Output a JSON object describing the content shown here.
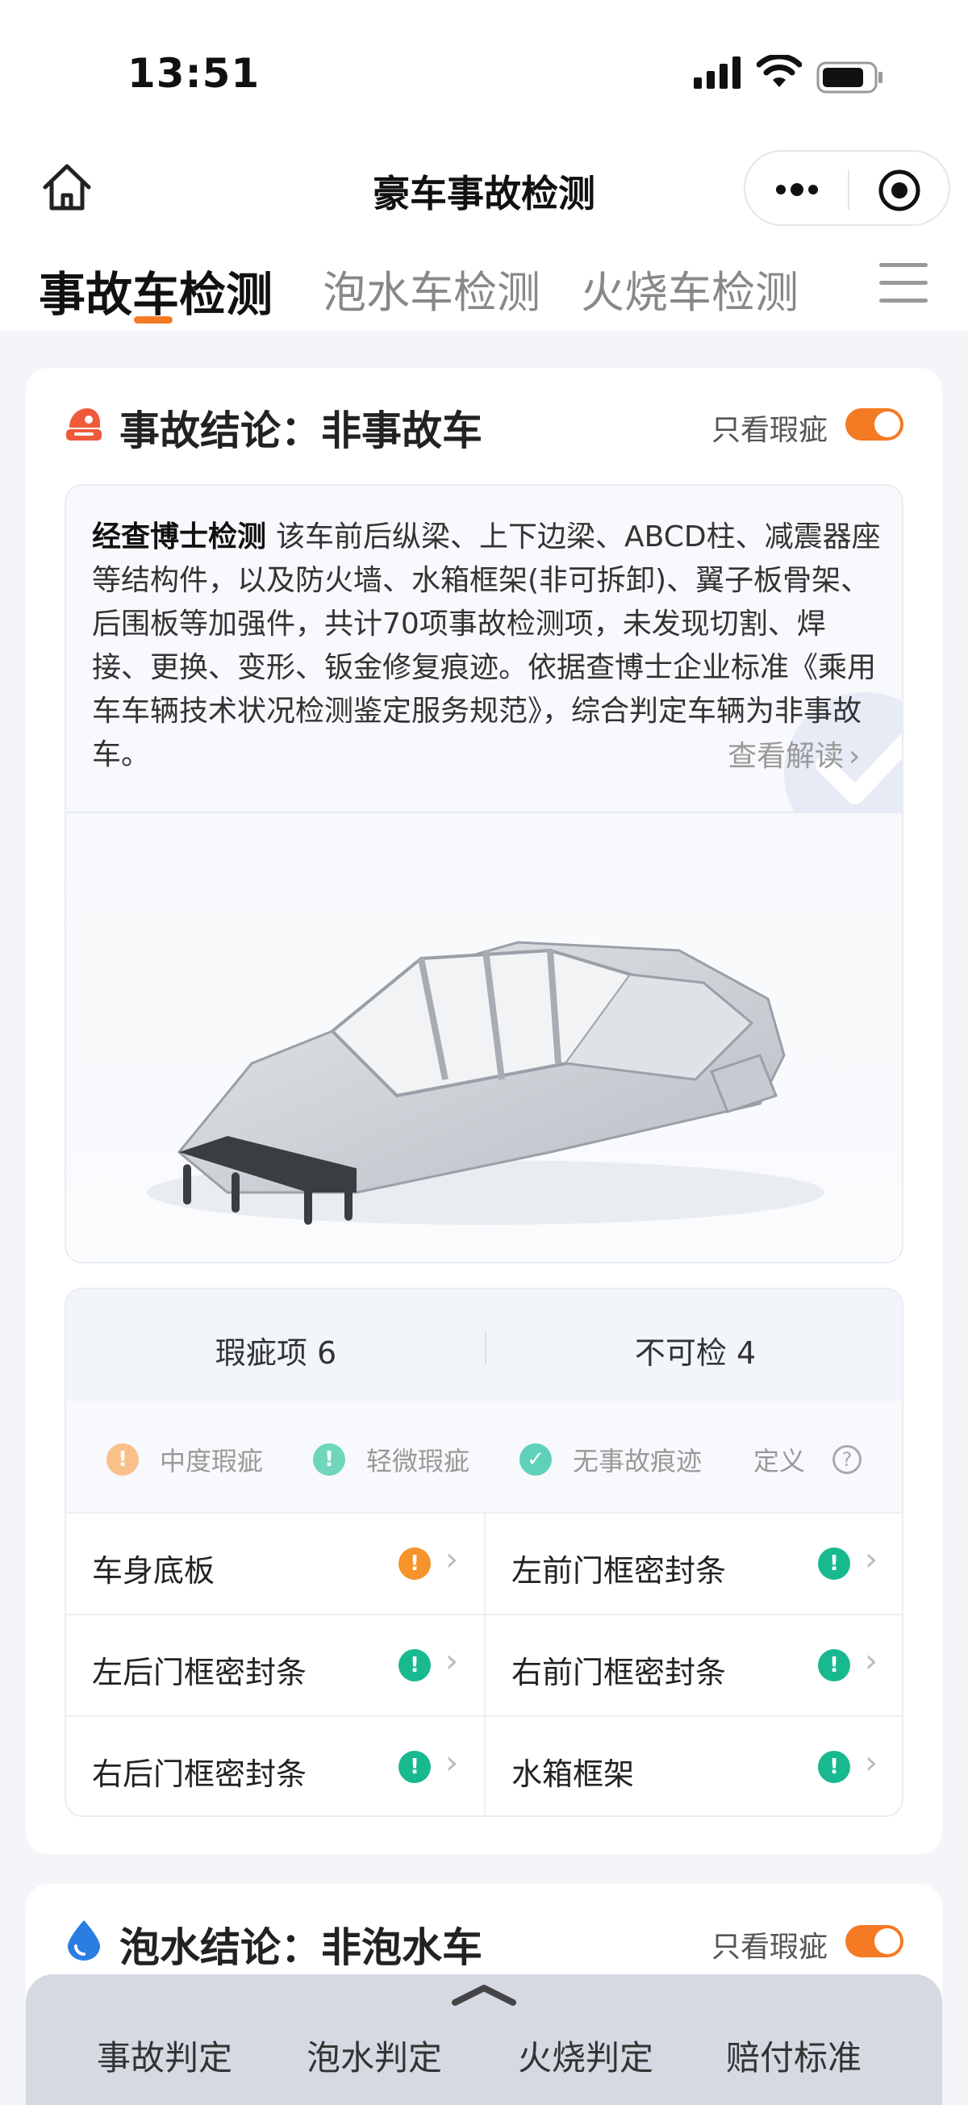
{
  "status": {
    "time": "13:51"
  },
  "nav": {
    "title": "豪车事故检测"
  },
  "tabs": [
    {
      "label": "事故车检测",
      "active": true
    },
    {
      "label": "泡水车检测",
      "active": false
    },
    {
      "label": "火烧车检测",
      "active": false
    }
  ],
  "accident": {
    "title": "事故结论：非事故车",
    "toggle_label": "只看瑕疵",
    "toggle_on": true,
    "brand": "经查博士检测",
    "text": "该车前后纵梁、上下边梁、ABCD柱、减震器座等结构件，以及防火墙、水箱框架(非可拆卸)、翼子板骨架、后围板等加强件，共计70项事故检测项，未发现切割、焊接、更换、变形、钣金修复痕迹。依据查博士企业标准《乘用车车辆技术状况检测鉴定服务规范》，综合判定车辆为非事故车。",
    "read_more": "查看解读"
  },
  "summary": {
    "flaws": "瑕疵项 6",
    "uncheckable": "不可检 4"
  },
  "legend": {
    "medium": "中度瑕疵",
    "minor": "轻微瑕疵",
    "none": "无事故痕迹",
    "definition": "定义"
  },
  "items": [
    {
      "name": "车身底板",
      "level": "medium"
    },
    {
      "name": "左前门框密封条",
      "level": "minor"
    },
    {
      "name": "左后门框密封条",
      "level": "minor"
    },
    {
      "name": "右前门框密封条",
      "level": "minor"
    },
    {
      "name": "右后门框密封条",
      "level": "minor"
    },
    {
      "name": "水箱框架",
      "level": "minor"
    }
  ],
  "flood": {
    "title": "泡水结论：非泡水车",
    "toggle_label": "只看瑕疵",
    "toggle_on": true
  },
  "bottom_nav": [
    "事故判定",
    "泡水判定",
    "火烧判定",
    "赔付标准"
  ],
  "colors": {
    "accent": "#f47a24",
    "medium": "#f7932b",
    "minor": "#19b98f",
    "ok": "#2fc7a6",
    "water": "#2a7de1"
  }
}
